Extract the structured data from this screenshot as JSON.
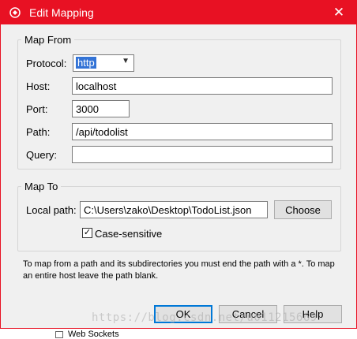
{
  "window": {
    "title": "Edit Mapping"
  },
  "map_from": {
    "legend": "Map From",
    "protocol_label": "Protocol:",
    "protocol_value": "http",
    "host_label": "Host:",
    "host_value": "localhost",
    "port_label": "Port:",
    "port_value": "3000",
    "path_label": "Path:",
    "path_value": "/api/todolist",
    "query_label": "Query:",
    "query_value": ""
  },
  "map_to": {
    "legend": "Map To",
    "local_path_label": "Local path:",
    "local_path_value": "C:\\Users\\zako\\Desktop\\TodoList.json",
    "choose_label": "Choose",
    "case_sensitive_label": "Case-sensitive",
    "case_sensitive_checked": true
  },
  "hint": "To map from a path and its subdirectories you must end the path with a *. To map an entire host leave the path blank.",
  "buttons": {
    "ok": "OK",
    "cancel": "Cancel",
    "help": "Help"
  },
  "watermark": "https://blog.csdn.net/u011215669",
  "background": {
    "bottom_text": "Web Sockets"
  },
  "colors": {
    "titlebar": "#e81123",
    "selection": "#3373d6",
    "focus_border": "#0078d7"
  }
}
